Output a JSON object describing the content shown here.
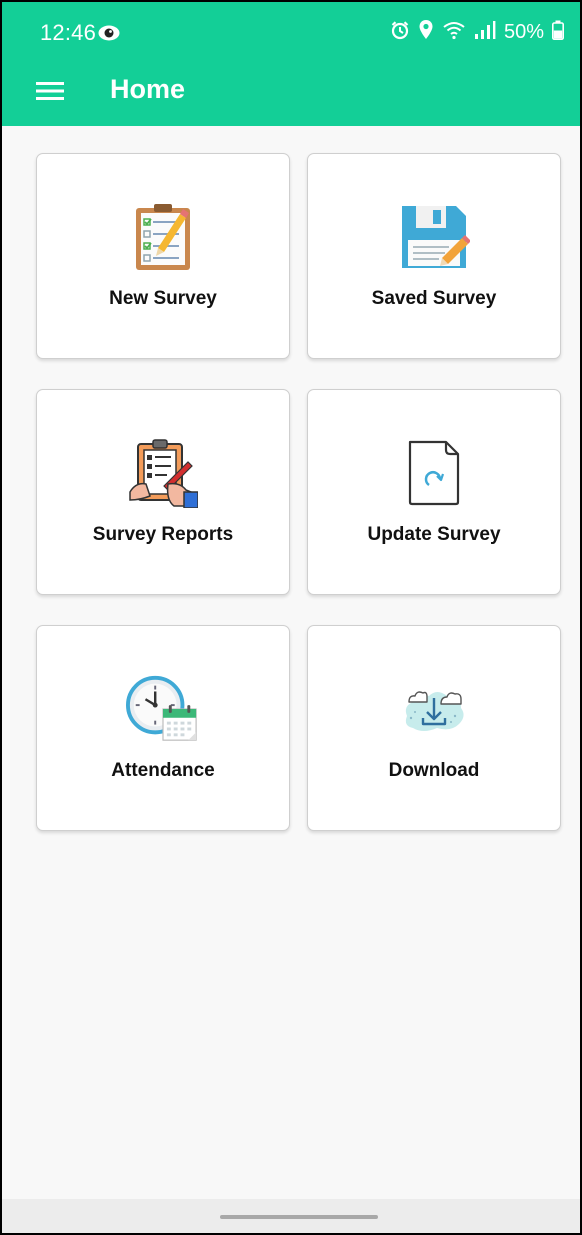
{
  "status_bar": {
    "time": "12:46",
    "battery": "50%"
  },
  "toolbar": {
    "title": "Home"
  },
  "menu": {
    "items": [
      {
        "label": "New Survey",
        "icon": "checklist-clipboard-icon"
      },
      {
        "label": "Saved Survey",
        "icon": "floppy-disk-icon"
      },
      {
        "label": "Survey Reports",
        "icon": "clipboard-writing-icon"
      },
      {
        "label": "Update Survey",
        "icon": "update-document-icon"
      },
      {
        "label": "Attendance",
        "icon": "clock-calendar-icon"
      },
      {
        "label": "Download",
        "icon": "cloud-download-icon"
      }
    ]
  },
  "colors": {
    "appbar": "#13cf97",
    "background": "#f8f8f8",
    "card": "#ffffff"
  }
}
